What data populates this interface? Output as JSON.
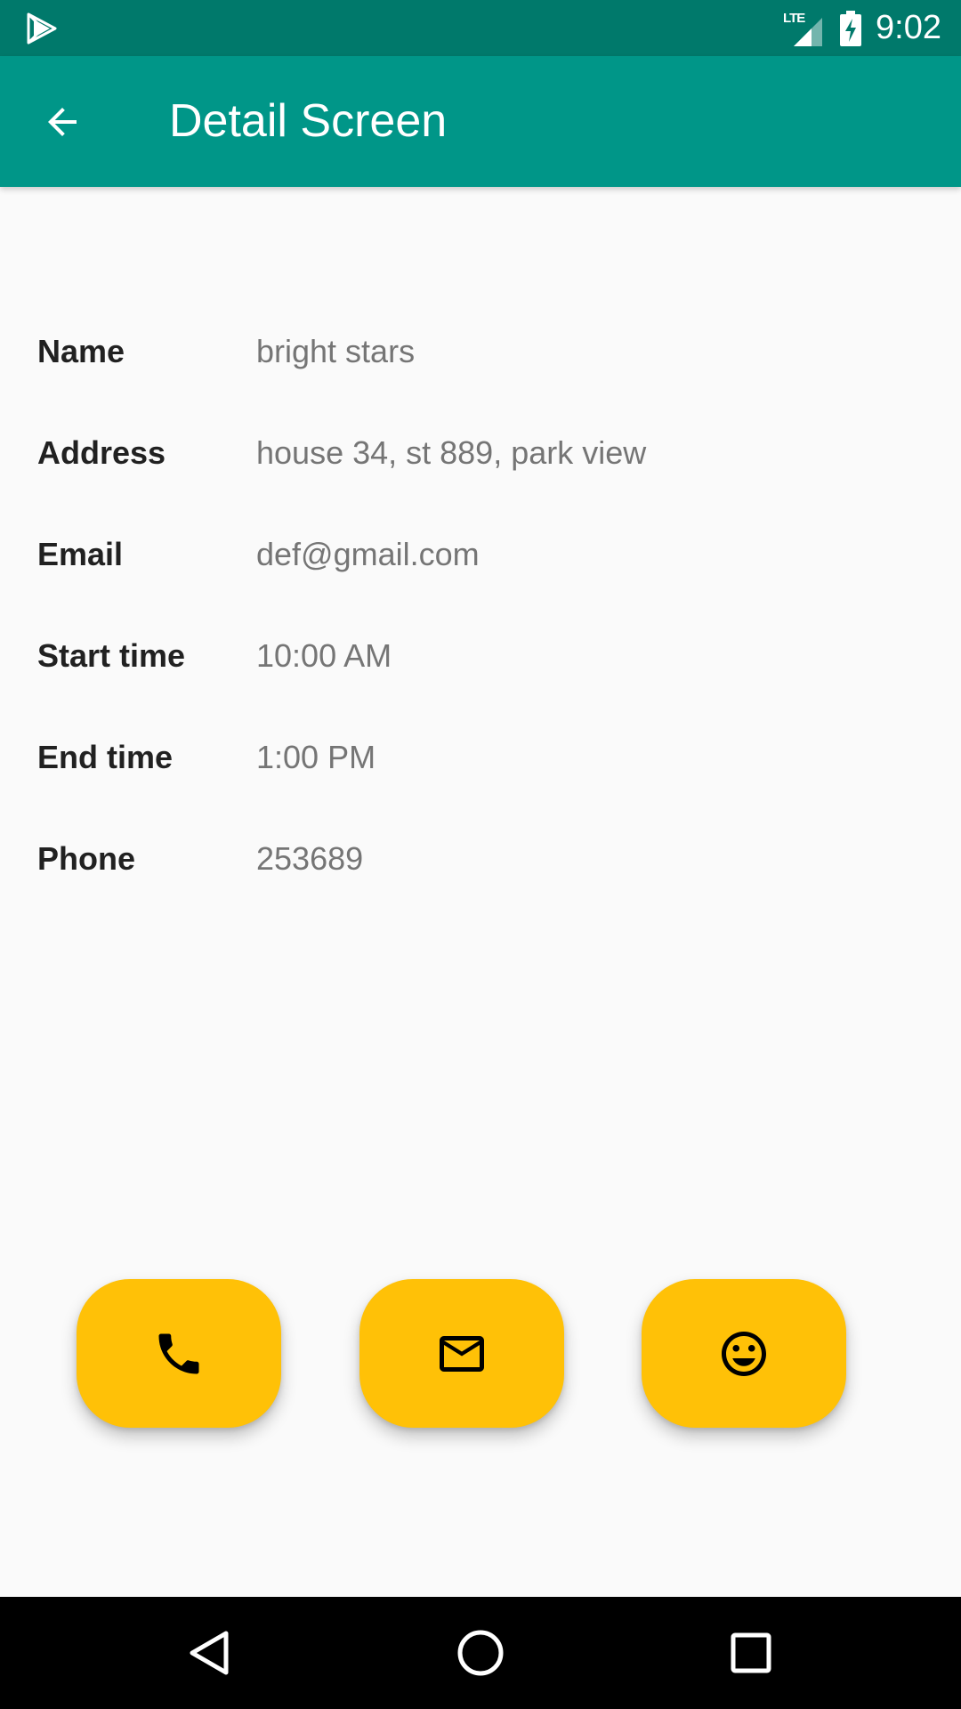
{
  "status_bar": {
    "network": "LTE",
    "time": "9:02",
    "icons": [
      "play-store-icon",
      "lte-signal-icon",
      "battery-charging-icon"
    ]
  },
  "app_bar": {
    "title": "Detail Screen",
    "back_icon": "arrow-back-icon"
  },
  "details": {
    "rows": [
      {
        "label": "Name",
        "value": "bright stars"
      },
      {
        "label": "Address",
        "value": "house 34, st 889, park view"
      },
      {
        "label": "Email",
        "value": "def@gmail.com"
      },
      {
        "label": "Start time",
        "value": "10:00 AM"
      },
      {
        "label": "End time",
        "value": "1:00 PM"
      },
      {
        "label": "Phone",
        "value": "253689"
      }
    ]
  },
  "actions": {
    "buttons": [
      {
        "icon": "phone-icon"
      },
      {
        "icon": "mail-icon"
      },
      {
        "icon": "smiley-icon"
      }
    ]
  },
  "nav_bar": {
    "buttons": [
      "back-triangle-icon",
      "home-circle-icon",
      "recents-square-icon"
    ]
  },
  "colors": {
    "status_bar": "#00796b",
    "app_bar": "#009688",
    "accent": "#ffc107",
    "background": "#fafafa",
    "label": "#212121",
    "value": "#757575"
  }
}
